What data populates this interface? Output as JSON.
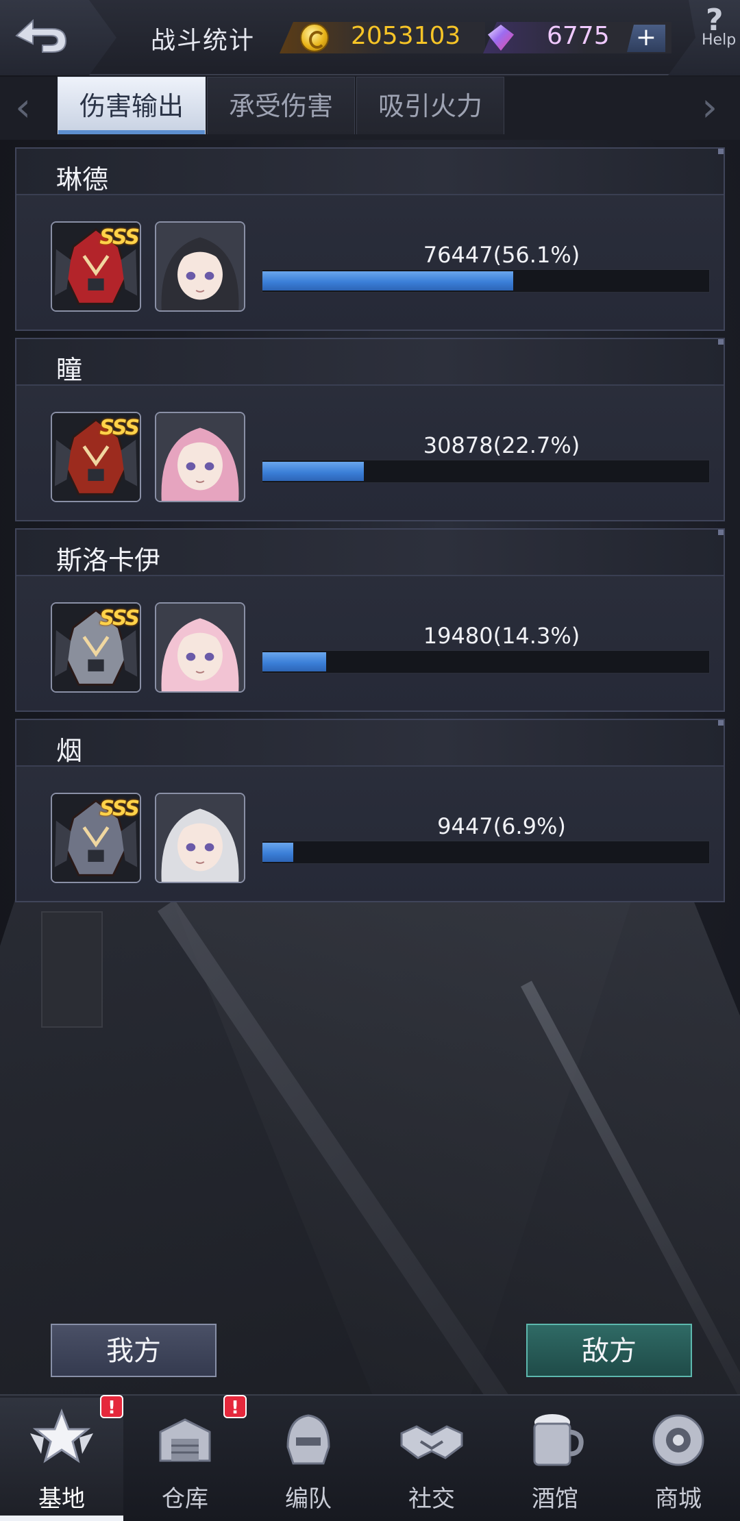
{
  "header": {
    "title": "战斗统计",
    "gold": "2053103",
    "gems": "6775",
    "plus_label": "+",
    "help_symbol": "?",
    "help_label": "Help"
  },
  "tabs": [
    {
      "label": "伤害输出",
      "active": true
    },
    {
      "label": "承受伤害",
      "active": false
    },
    {
      "label": "吸引火力",
      "active": false
    }
  ],
  "players": [
    {
      "name": "琳德",
      "stat": "76447(56.1%)",
      "percent": 56.1,
      "rank_badge": "SSS",
      "mech_color": "#b3242a",
      "hair_color": "#2d2e36"
    },
    {
      "name": "瞳",
      "stat": "30878(22.7%)",
      "percent": 22.7,
      "rank_badge": "SSS",
      "mech_color": "#9c2b1e",
      "hair_color": "#e6a4bf"
    },
    {
      "name": "斯洛卡伊",
      "stat": "19480(14.3%)",
      "percent": 14.3,
      "rank_badge": "SSS",
      "mech_color": "#8a8f9c",
      "hair_color": "#f2c3d3"
    },
    {
      "name": "烟",
      "stat": "9447(6.9%)",
      "percent": 6.9,
      "rank_badge": "SSS",
      "mech_color": "#6f7486",
      "hair_color": "#dcdde2"
    }
  ],
  "buttons": {
    "our_side": "我方",
    "enemy_side": "敌方"
  },
  "nav": [
    {
      "label": "基地",
      "icon": "base-emblem-icon",
      "active": true,
      "badge": "!"
    },
    {
      "label": "仓库",
      "icon": "warehouse-icon",
      "active": false,
      "badge": "!"
    },
    {
      "label": "编队",
      "icon": "formation-helmet-icon",
      "active": false,
      "badge": ""
    },
    {
      "label": "社交",
      "icon": "handshake-icon",
      "active": false,
      "badge": ""
    },
    {
      "label": "酒馆",
      "icon": "tavern-mug-icon",
      "active": false,
      "badge": ""
    },
    {
      "label": "商城",
      "icon": "shop-orb-icon",
      "active": false,
      "badge": ""
    }
  ],
  "colors": {
    "bar_fill": "#3b7fd8",
    "gold_text": "#f6c427",
    "gem_text": "#f0c9ff",
    "badge_red": "#e5283c"
  }
}
